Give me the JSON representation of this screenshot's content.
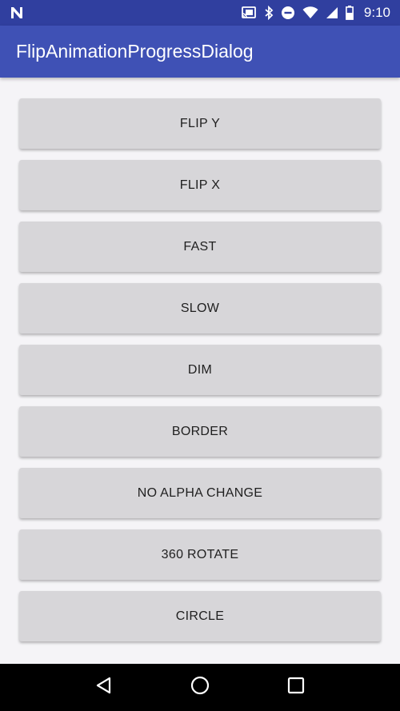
{
  "status_bar": {
    "time": "9:10",
    "icons": [
      "notification-n-icon",
      "cast-icon",
      "bluetooth-icon",
      "do-not-disturb-icon",
      "wifi-icon",
      "cell-signal-icon",
      "battery-icon"
    ]
  },
  "app_bar": {
    "title": "FlipAnimationProgressDialog"
  },
  "buttons": [
    {
      "label": "FLIP Y"
    },
    {
      "label": "FLIP X"
    },
    {
      "label": "FAST"
    },
    {
      "label": "SLOW"
    },
    {
      "label": "DIM"
    },
    {
      "label": "BORDER"
    },
    {
      "label": "NO ALPHA CHANGE"
    },
    {
      "label": "360 ROTATE"
    },
    {
      "label": "CIRCLE"
    }
  ],
  "nav_bar": {
    "icons": [
      "back-icon",
      "home-icon",
      "recents-icon"
    ]
  },
  "colors": {
    "status_bar": "#303f9f",
    "app_bar": "#3f51b5",
    "background": "#f5f4f7",
    "button": "#d7d6d9",
    "nav_bar": "#000000"
  }
}
